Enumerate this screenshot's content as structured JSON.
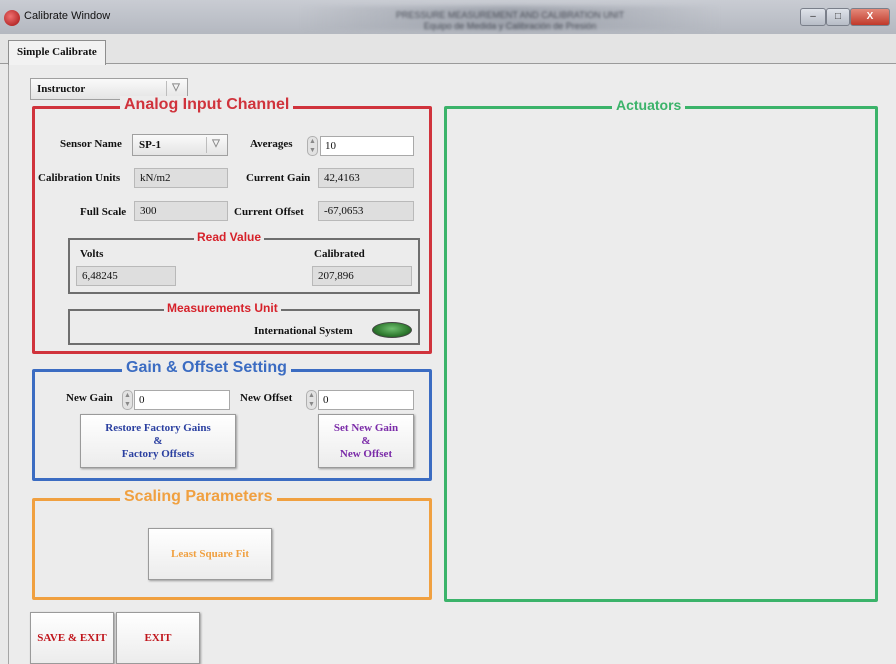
{
  "window": {
    "title": "Calibrate Window",
    "blurred_caption": "PRESSURE MEASUREMENT AND CALIBRATION UNIT\nEquipo de Medida y Calibración de Presión",
    "minimize": "–",
    "maximize": "□",
    "close": "X"
  },
  "tabs": [
    {
      "label": "Simple Calibrate",
      "selected": true
    }
  ],
  "user_mode": {
    "selected": "Instructor"
  },
  "analog": {
    "title": "Analog Input Channel",
    "color": "#d0333c",
    "sensor_name_label": "Sensor Name",
    "sensor_name_value": "SP-1",
    "averages_label": "Averages",
    "averages_value": "10",
    "calibration_units_label": "Calibration Units",
    "calibration_units_value": "kN/m2",
    "current_gain_label": "Current Gain",
    "current_gain_value": "42,4163",
    "full_scale_label": "Full Scale",
    "full_scale_value": "300",
    "current_offset_label": "Current Offset",
    "current_offset_value": "-67,0653",
    "read_value": {
      "title": "Read Value",
      "volts_label": "Volts",
      "volts_value": "6,48245",
      "calibrated_label": "Calibrated",
      "calibrated_value": "207,896"
    },
    "measurements_unit": {
      "title": "Measurements Unit",
      "system_label": "International System",
      "led_color": "#2f7a2f"
    }
  },
  "gain_offset": {
    "title": "Gain & Offset Setting",
    "color": "#3b6cc2",
    "new_gain_label": "New Gain",
    "new_gain_value": "0",
    "new_offset_label": "New Offset",
    "new_offset_value": "0",
    "restore_button": {
      "line1": "Restore Factory Gains",
      "line2": "&",
      "line3": "Factory Offsets",
      "color": "#2a3fa0"
    },
    "set_button": {
      "line1": "Set New Gain",
      "line2": "&",
      "line3": "New Offset",
      "color": "#7a2aa8"
    }
  },
  "scaling": {
    "title": "Scaling Parameters",
    "color": "#f0a040",
    "least_square_label": "Least Square Fit"
  },
  "actuators": {
    "title": "Actuators",
    "color": "#3bb36a"
  },
  "footer": {
    "save_exit": "SAVE & EXIT",
    "exit": "EXIT",
    "button_color": "#c0151c"
  }
}
